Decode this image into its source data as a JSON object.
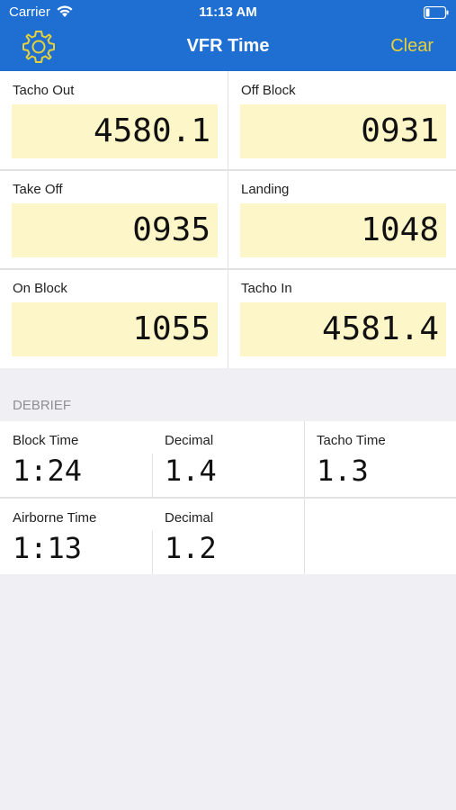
{
  "status_bar": {
    "carrier": "Carrier",
    "time": "11:13 AM",
    "wifi_icon": "wifi-icon",
    "battery_icon": "battery-icon"
  },
  "nav": {
    "title": "VFR Time",
    "settings_icon": "gear-icon",
    "clear_label": "Clear"
  },
  "colors": {
    "nav_background": "#1f6fd3",
    "accent": "#e6d13a",
    "field_background": "#fdf6c9"
  },
  "inputs": {
    "tacho_out": {
      "label": "Tacho Out",
      "value": "4580.1"
    },
    "off_block": {
      "label": "Off Block",
      "value": "0931"
    },
    "take_off": {
      "label": "Take Off",
      "value": "0935"
    },
    "landing": {
      "label": "Landing",
      "value": "1048"
    },
    "on_block": {
      "label": "On Block",
      "value": "1055"
    },
    "tacho_in": {
      "label": "Tacho In",
      "value": "4581.4"
    }
  },
  "debrief": {
    "header": "DEBRIEF",
    "block_time": {
      "label": "Block Time",
      "value": "1:24"
    },
    "block_decimal": {
      "label": "Decimal",
      "value": "1.4"
    },
    "tacho_time": {
      "label": "Tacho Time",
      "value": "1.3"
    },
    "airborne_time": {
      "label": "Airborne Time",
      "value": "1:13"
    },
    "airborne_decimal": {
      "label": "Decimal",
      "value": "1.2"
    }
  }
}
